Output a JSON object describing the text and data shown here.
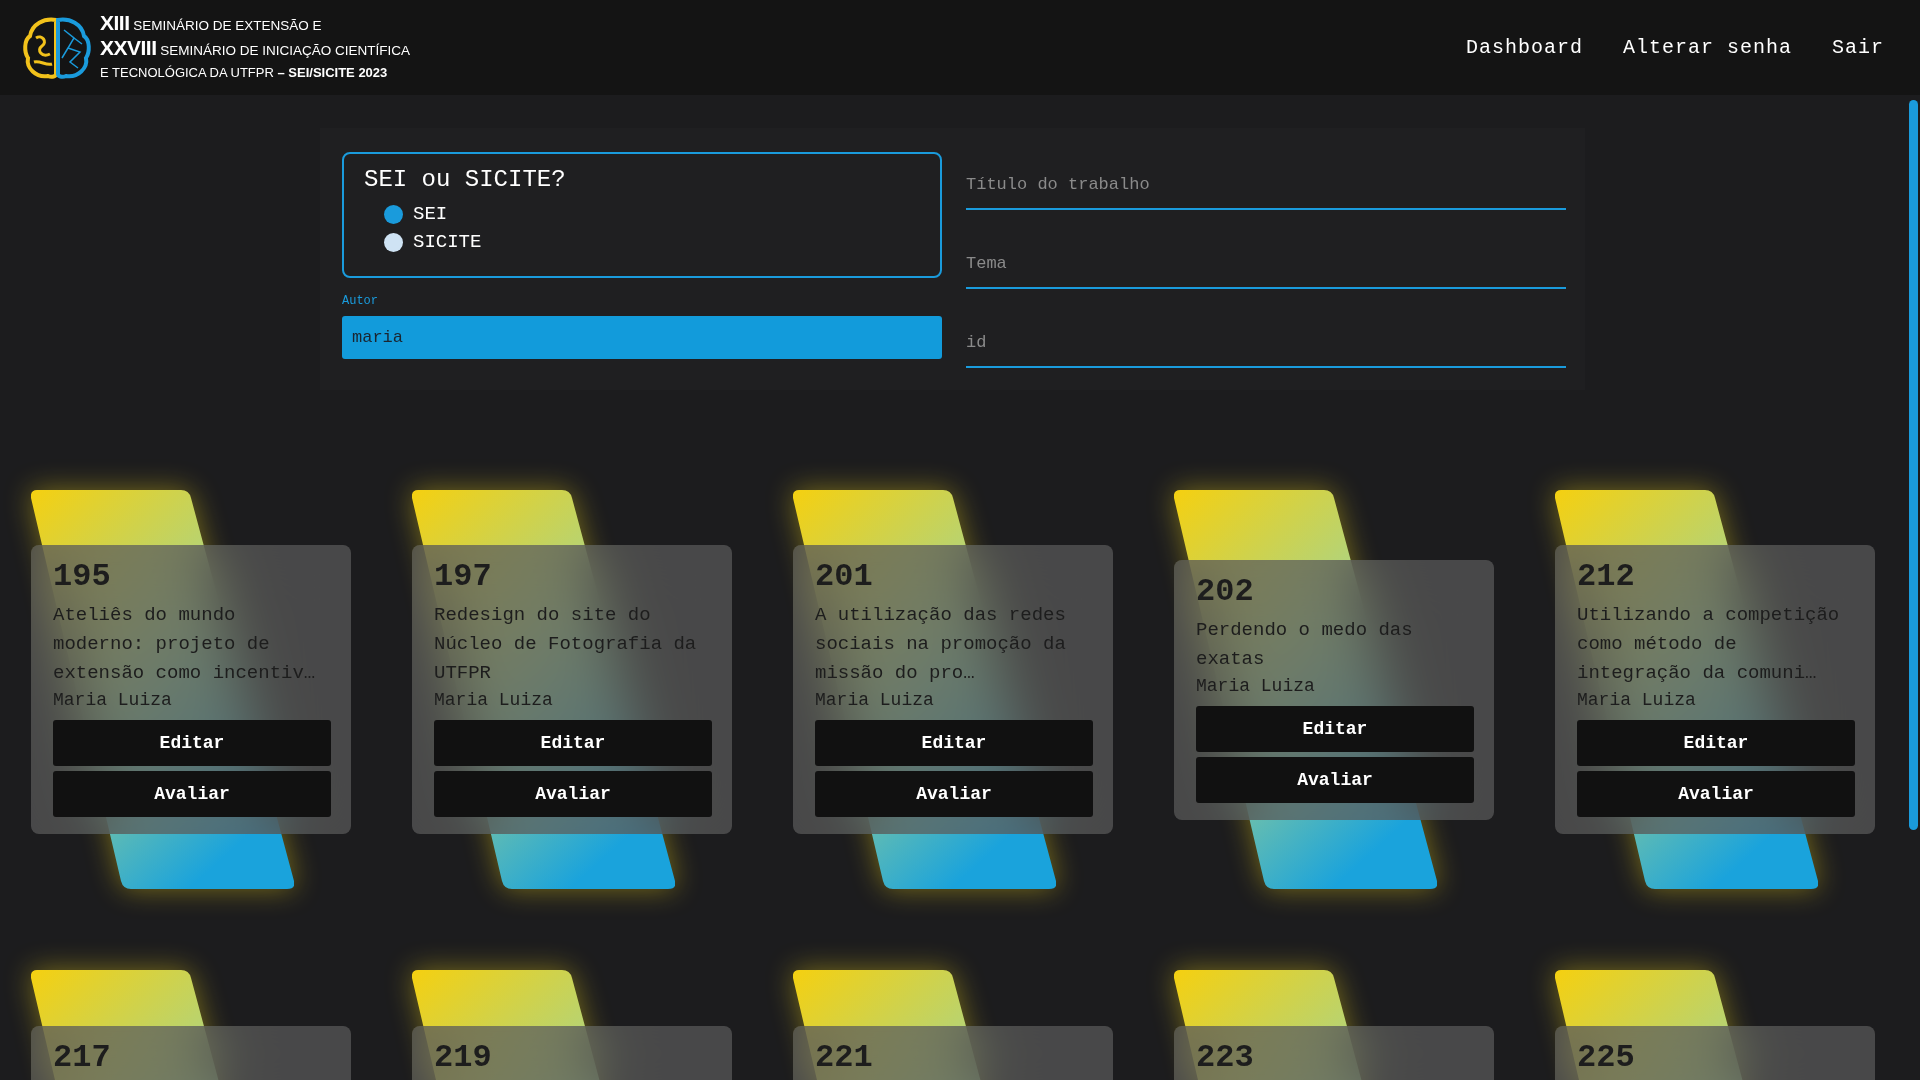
{
  "logo": {
    "lines": [
      {
        "kind": "big",
        "text": "**XIII** SEMINÁRIO DE EXTENSÃO E"
      },
      {
        "kind": "big",
        "text": "**XXVIII** SEMINÁRIO DE INICIAÇÃO CIENTÍFICA"
      },
      {
        "kind": "small",
        "text": "E TECNOLÓGICA DA UTFPR **– SEI/SICITE 2023**"
      }
    ]
  },
  "nav": [
    "Dashboard",
    "Alterar senha",
    "Sair"
  ],
  "filters": {
    "event": {
      "legend": "SEI ou SICITE?",
      "options": [
        {
          "label": "SEI",
          "selected": true
        },
        {
          "label": "SICITE",
          "selected": false
        }
      ]
    },
    "author": {
      "label": "Autor",
      "value": "maria"
    },
    "fields": [
      {
        "placeholder": "Título do trabalho"
      },
      {
        "placeholder": "Tema"
      },
      {
        "placeholder": "id"
      }
    ]
  },
  "projects": [
    {
      "number": "195",
      "title": "Ateliês do mundo moderno: projeto de extensão como incentiv…",
      "author": "Maria Luiza",
      "actions": [
        "Editar",
        "Avaliar"
      ]
    },
    {
      "number": "197",
      "title": "Redesign do site do Núcleo de Fotografia da UTFPR",
      "author": "Maria Luiza",
      "actions": [
        "Editar",
        "Avaliar"
      ]
    },
    {
      "number": "201",
      "title": "A utilização das redes sociais na promoção da missão do pro…",
      "author": "Maria Luiza",
      "actions": [
        "Editar",
        "Avaliar"
      ]
    },
    {
      "number": "202",
      "title": "Perdendo o medo das exatas",
      "author": "Maria Luiza",
      "actions": [
        "Editar",
        "Avaliar"
      ]
    },
    {
      "number": "212",
      "title": "Utilizando a competição como método de integração da comuni…",
      "author": "Maria Luiza",
      "actions": [
        "Editar",
        "Avaliar"
      ]
    },
    {
      "number": "217"
    },
    {
      "number": "219"
    },
    {
      "number": "221"
    },
    {
      "number": "223"
    },
    {
      "number": "225"
    }
  ]
}
